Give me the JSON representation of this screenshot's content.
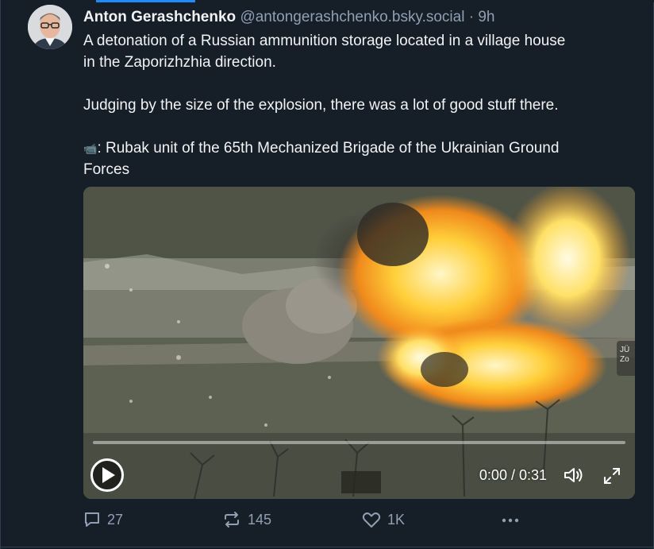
{
  "post": {
    "author_name": "Anton Gerashchenko",
    "author_handle": "@antongerashchenko.bsky.social",
    "separator": "·",
    "time": "9h",
    "text_line_1": "A detonation of a Russian ammunition storage located in a village house",
    "text_line_2": "in the Zaporizhzhia direction.",
    "text_line_3": "Judging by the size of the explosion, there was a lot of good stuff there.",
    "text_line_4": ": Rubak unit of the 65th Mechanized Brigade of the Ukrainian Ground",
    "text_line_5": "Forces",
    "camera_emoji": "📹"
  },
  "video": {
    "current_time": "0:00",
    "duration": "0:31",
    "time_readout": "0:00 / 0:31",
    "progress": 0,
    "badge_text": "JÜ\nZo"
  },
  "actions": {
    "reply_count": "27",
    "repost_count": "145",
    "like_count": "1K",
    "more_icon": "ellipsis-icon"
  },
  "colors": {
    "background": "#161e27",
    "text_primary": "#f1f3f5",
    "text_secondary": "#8fa0b3",
    "accent": "#208bfe"
  }
}
